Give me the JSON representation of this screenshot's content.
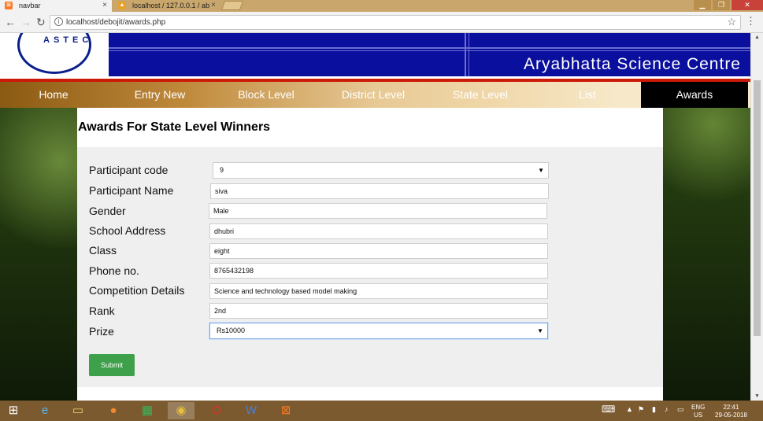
{
  "browser": {
    "tabs": [
      {
        "title": "navbar",
        "icon": "xampp-icon"
      },
      {
        "title": "localhost / 127.0.0.1 / ab",
        "icon": "phpmyadmin-icon"
      }
    ],
    "url": "localhost/debojit/awards.php"
  },
  "site": {
    "logo_text": "ASTEC",
    "title": "Aryabhatta Science Centre"
  },
  "nav": {
    "items": [
      "Home",
      "Entry New",
      "Block Level",
      "District Level",
      "State Level",
      "List",
      "Awards"
    ],
    "active": "Awards"
  },
  "page": {
    "title": "Awards For State Level Winners"
  },
  "form": {
    "participant_code_label": "Participant code",
    "participant_code_value": "9",
    "participant_name_label": "Participant Name",
    "participant_name_value": "siva",
    "gender_label": "Gender",
    "gender_value": "Male",
    "school_address_label": "School Address",
    "school_address_value": "dhubri",
    "class_label": "Class",
    "class_value": "eight",
    "phone_label": "Phone no.",
    "phone_value": "8765432198",
    "competition_label": "Competition Details",
    "competition_value": "Science and technology based model making",
    "rank_label": "Rank",
    "rank_value": "2nd",
    "prize_label": "Prize",
    "prize_value": "Rs10000",
    "submit_label": "Submit"
  },
  "taskbar": {
    "language": "ENG",
    "region": "US",
    "time": "22:41",
    "date": "29-05-2018"
  },
  "colors": {
    "banner": "#0b0f9e",
    "accent_red": "#cc1a08",
    "submit_green": "#3ea04a",
    "nav_active": "#000000"
  }
}
